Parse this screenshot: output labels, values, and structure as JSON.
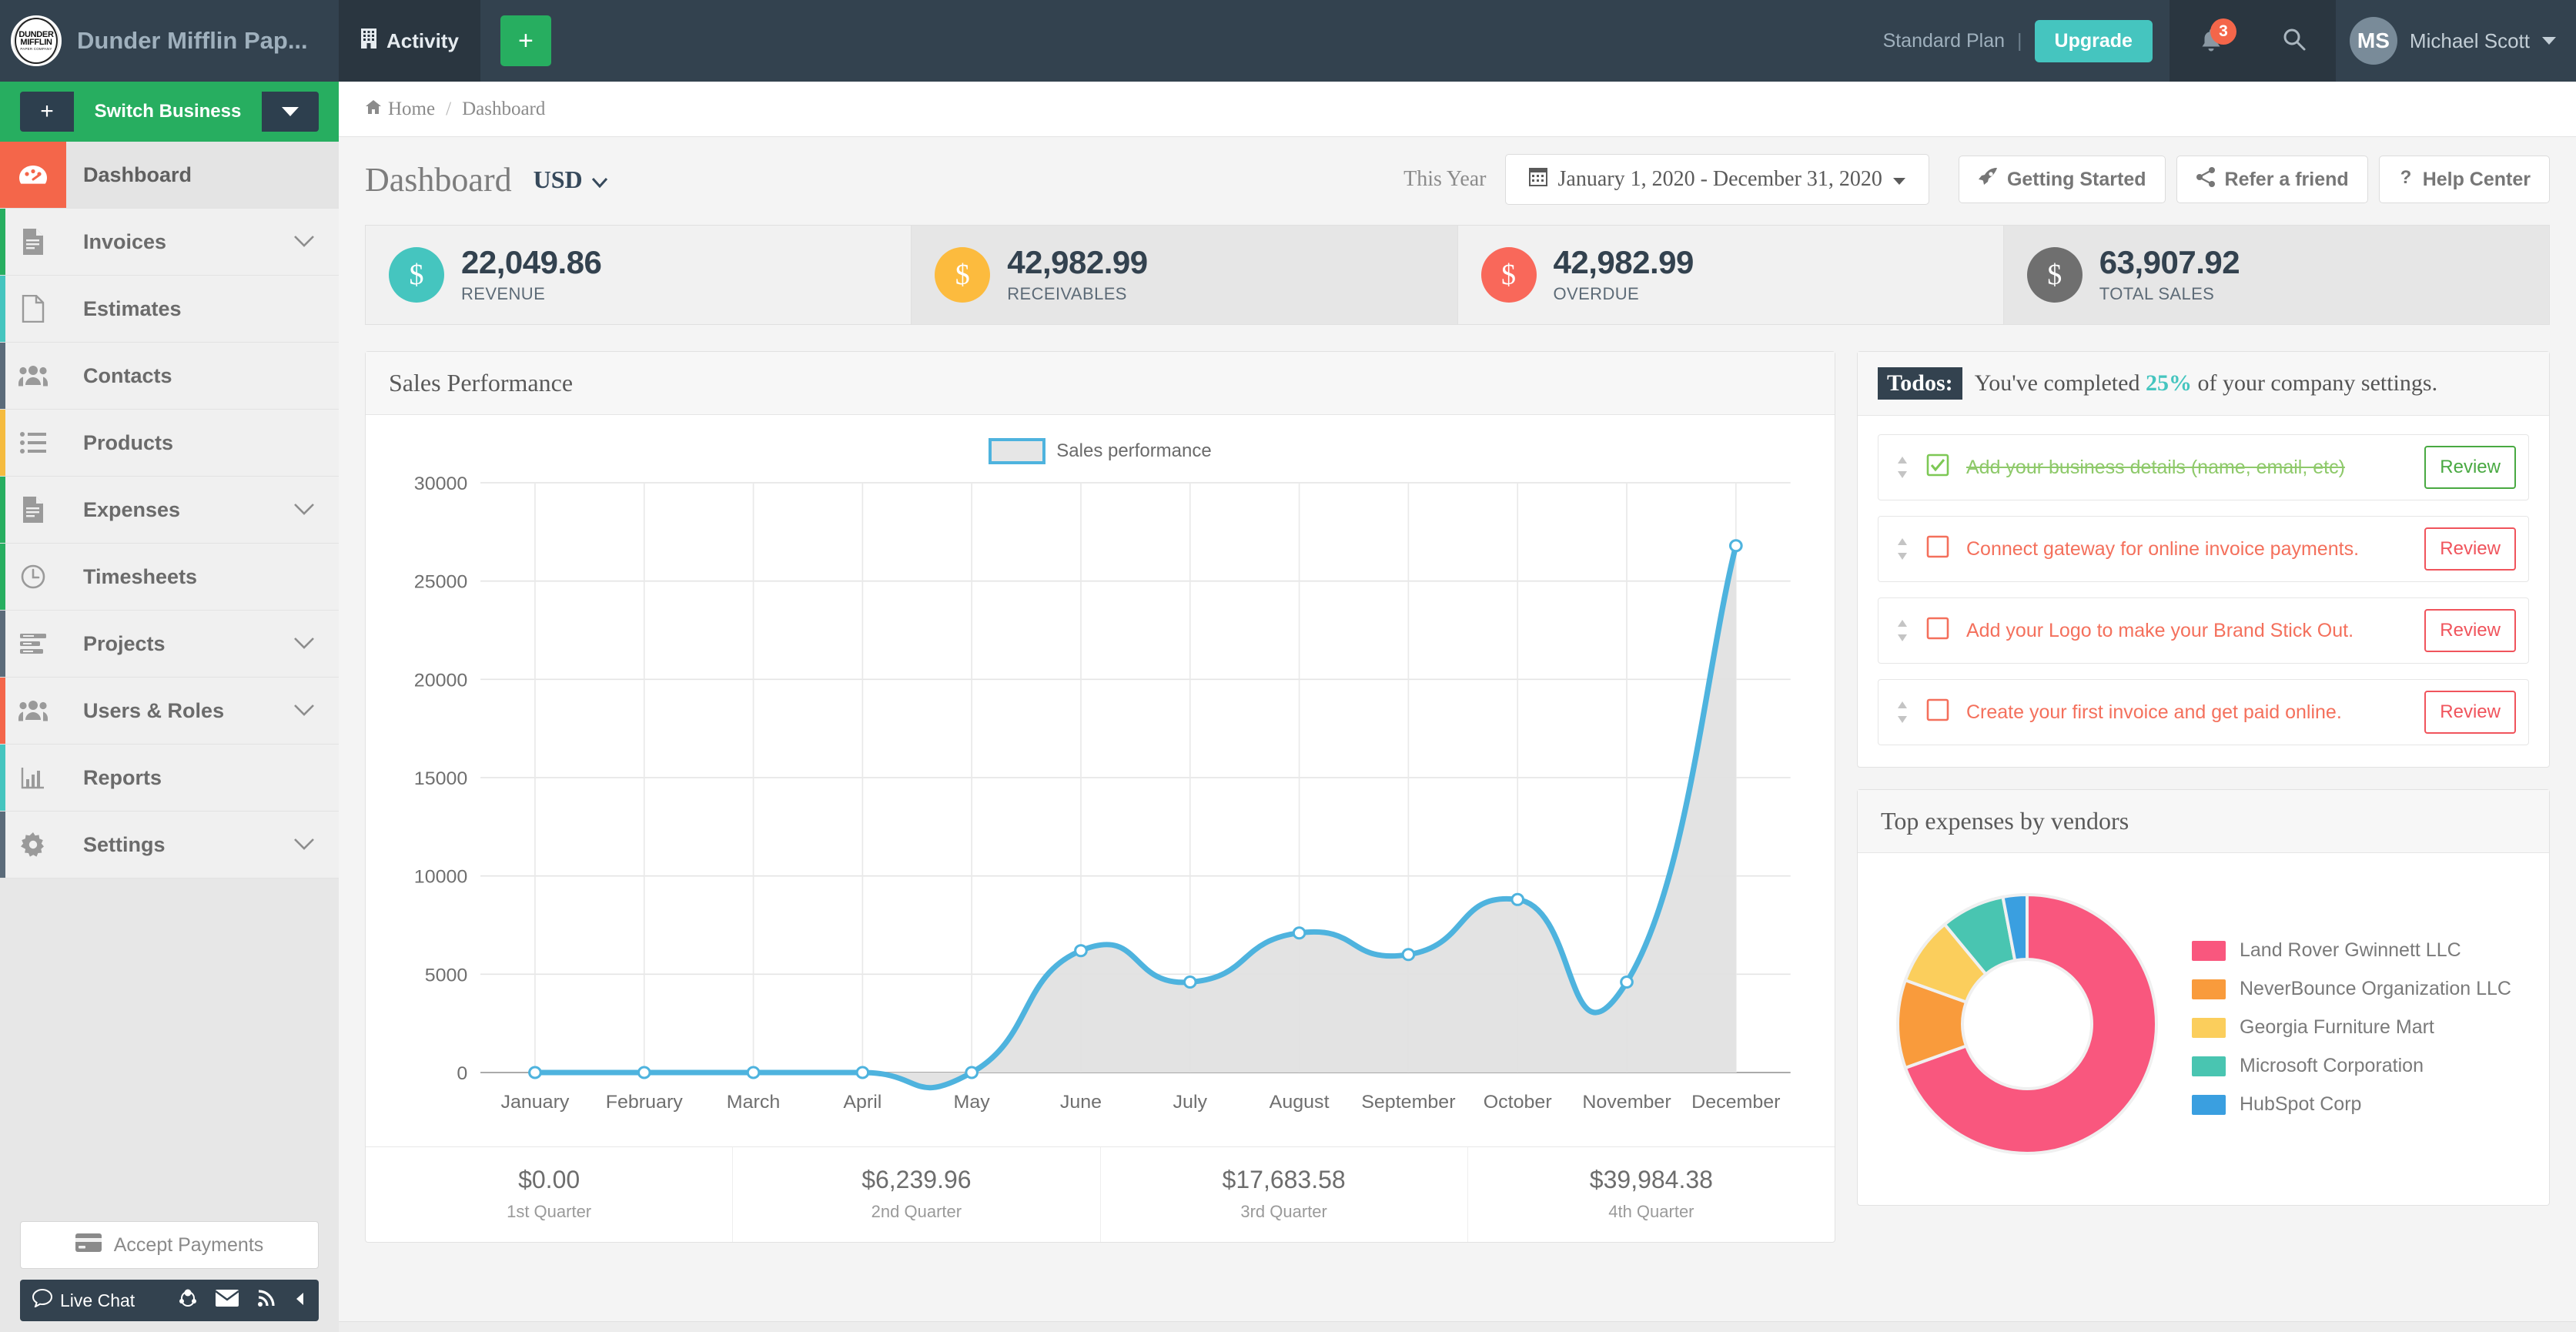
{
  "topbar": {
    "logo_line1": "DUNDER",
    "logo_line2": "MIFFLIN",
    "logo_line3": "PAPER COMPANY",
    "business_name": "Dunder Mifflin Pap...",
    "activity_label": "Activity",
    "add_label": "+",
    "plan_label": "Standard  Plan",
    "plan_separator": "|",
    "upgrade_label": "Upgrade",
    "notification_count": "3",
    "user_initials": "MS",
    "user_name": "Michael Scott"
  },
  "sidebar": {
    "switch_plus": "+",
    "switch_label": "Switch Business",
    "items": [
      {
        "label": "Dashboard",
        "icon": "dashboard-icon",
        "accent": "#f4664a",
        "active": true,
        "chevron": false
      },
      {
        "label": "Invoices",
        "icon": "invoice-icon",
        "accent": "#27ae60",
        "active": false,
        "chevron": true
      },
      {
        "label": "Estimates",
        "icon": "file-icon",
        "accent": "#45c5bf",
        "active": false,
        "chevron": false
      },
      {
        "label": "Contacts",
        "icon": "users-icon",
        "accent": "#5b6b7a",
        "active": false,
        "chevron": false
      },
      {
        "label": "Products",
        "icon": "list-icon",
        "accent": "#f5bb3f",
        "active": false,
        "chevron": false
      },
      {
        "label": "Expenses",
        "icon": "invoice-icon",
        "accent": "#27ae60",
        "active": false,
        "chevron": true
      },
      {
        "label": "Timesheets",
        "icon": "clock-icon",
        "accent": "#27ae60",
        "active": false,
        "chevron": false
      },
      {
        "label": "Projects",
        "icon": "tasks-icon",
        "accent": "#5b6b7a",
        "active": false,
        "chevron": true
      },
      {
        "label": "Users & Roles",
        "icon": "users-icon",
        "accent": "#f4664a",
        "active": false,
        "chevron": true
      },
      {
        "label": "Reports",
        "icon": "bar-chart-icon",
        "accent": "#45c5bf",
        "active": false,
        "chevron": false
      },
      {
        "label": "Settings",
        "icon": "gear-icon",
        "accent": "#5b6b7a",
        "active": false,
        "chevron": true
      }
    ],
    "accept_payments_label": "Accept Payments",
    "live_chat_label": "Live Chat"
  },
  "breadcrumb": {
    "home": "Home",
    "separator": "/",
    "current": "Dashboard"
  },
  "page_header": {
    "title": "Dashboard",
    "currency": "USD",
    "range_label": "This Year",
    "date_range": "January 1, 2020 - December 31, 2020",
    "buttons": [
      {
        "label": "Getting Started",
        "icon": "rocket-icon"
      },
      {
        "label": "Refer a friend",
        "icon": "share-icon"
      },
      {
        "label": "Help Center",
        "icon": "question-icon"
      }
    ]
  },
  "stats": [
    {
      "value": "22,049.86",
      "label": "REVENUE",
      "color": "#45c5bf",
      "symbol": "$",
      "alt": false
    },
    {
      "value": "42,982.99",
      "label": "RECEIVABLES",
      "color": "#fcbb3e",
      "symbol": "$",
      "alt": true
    },
    {
      "value": "42,982.99",
      "label": "OVERDUE",
      "color": "#f9685a",
      "symbol": "$",
      "alt": false
    },
    {
      "value": "63,907.92",
      "label": "TOTAL SALES",
      "color": "#6f6f6f",
      "symbol": "$",
      "alt": true
    }
  ],
  "sales_panel": {
    "title": "Sales Performance",
    "quarters": [
      {
        "value": "$0.00",
        "label": "1st Quarter"
      },
      {
        "value": "$6,239.96",
        "label": "2nd Quarter"
      },
      {
        "value": "$17,683.58",
        "label": "3rd Quarter"
      },
      {
        "value": "$39,984.38",
        "label": "4th Quarter"
      }
    ]
  },
  "todos": {
    "tag": "Todos:",
    "headline_before": "You've completed",
    "percent": "25%",
    "headline_after": "of your company settings.",
    "items": [
      {
        "text": "Add your business details (name, email, etc)",
        "done": true,
        "button": "Review"
      },
      {
        "text": "Connect gateway for online invoice payments.",
        "done": false,
        "button": "Review"
      },
      {
        "text": "Add your Logo to make your Brand Stick Out.",
        "done": false,
        "button": "Review"
      },
      {
        "text": "Create your first invoice and get paid online.",
        "done": false,
        "button": "Review"
      }
    ]
  },
  "vendors_panel": {
    "title": "Top expenses by vendors"
  },
  "chart_data": [
    {
      "type": "area",
      "title": "Sales Performance",
      "legend": [
        "Sales performance"
      ],
      "legend_position": "top-center",
      "xlabel": "",
      "ylabel": "",
      "categories": [
        "January",
        "February",
        "March",
        "April",
        "May",
        "June",
        "July",
        "August",
        "September",
        "October",
        "November",
        "December"
      ],
      "series": [
        {
          "name": "Sales performance",
          "values": [
            0,
            0,
            0,
            0,
            0,
            6200,
            4600,
            7100,
            6000,
            8800,
            4600,
            26800
          ],
          "line_color": "#4eb3de",
          "fill_color": "#e2e2e2"
        }
      ],
      "ylim": [
        0,
        30000
      ],
      "yticks": [
        0,
        5000,
        10000,
        15000,
        20000,
        25000,
        30000
      ],
      "ytick_labels": [
        "0",
        "5000",
        "10000",
        "15000",
        "20000",
        "25000",
        "30000"
      ],
      "grid": true
    },
    {
      "type": "pie",
      "variant": "donut",
      "title": "Top expenses by vendors",
      "labels": [
        "Land Rover Gwinnett LLC",
        "NeverBounce Organization LLC",
        "Georgia Furniture Mart",
        "Microsoft Corporation",
        "HubSpot Corp"
      ],
      "values": [
        69.5,
        11.0,
        8.5,
        8.0,
        3.0
      ],
      "colors": [
        "#f9577e",
        "#f99b3c",
        "#fbce5c",
        "#49c5b1",
        "#3a9fe0"
      ],
      "legend_position": "right"
    }
  ]
}
